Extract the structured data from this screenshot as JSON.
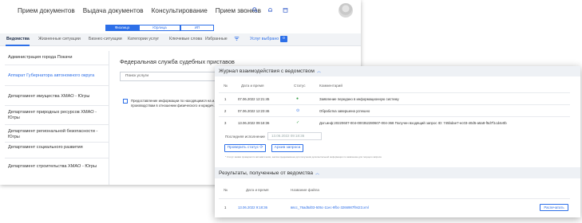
{
  "header": {
    "nav": [
      "Прием документов",
      "Выдача документов",
      "Консультирование",
      "Прием звонков"
    ],
    "icons": [
      "search-icon",
      "bell-icon",
      "calendar-icon"
    ]
  },
  "applicant_types": {
    "items": [
      "Физлицо",
      "Юрлица",
      "ИП"
    ],
    "active": "Физлицо"
  },
  "tabs": {
    "items": [
      "Ведомства",
      "Жизненные ситуации",
      "Бизнес-ситуации",
      "Категории услуг",
      "Ключевые слова",
      "Избранные"
    ],
    "active": "Ведомства",
    "selected_link": "Услуг выбрано",
    "selected_count": "0"
  },
  "sidebar": {
    "items": [
      {
        "label": "Администрация города Покачи"
      },
      {
        "label": "Аппарат Губернатора автономного округа"
      },
      {
        "label": "Департамент имущества ХМАО - Югры"
      },
      {
        "label": "Департамент природных ресурсов ХМАО - Югры"
      },
      {
        "label": "Департамент региональной безопасности - Югры"
      },
      {
        "label": "Департамент социального развития"
      },
      {
        "label": "Департамент строительства ХМАО - Югры"
      }
    ],
    "active_index": 1
  },
  "main": {
    "title": "Федеральная служба судебных приставов",
    "search_placeholder": "Поиск услуги",
    "service_text": "Предоставление информации по находящимся на и... производствам в отношении физического и юридич..."
  },
  "journal": {
    "title": "Журнал взаимодействия с ведомством",
    "columns": [
      "№",
      "Дата и время",
      "Статус",
      "Комментарий"
    ],
    "rows": [
      {
        "n": "1",
        "datetime": "07.06.2022 12:21:45",
        "status": "●",
        "comment": "Заявление передано в информационную систему"
      },
      {
        "n": "2",
        "datetime": "07.06.2022 12:23:46",
        "status": "⊙",
        "comment": "Обработка завершена успешно"
      },
      {
        "n": "3",
        "datetime": "13.06.2022 09:18:36",
        "status": "✓",
        "comment": "Доп.инф:20220607-004-000352280607-004-368 Получен входящий запрос ID: 745bdae7-ec03-40d5-a6a8-f5d7f1cd4e0b"
      }
    ],
    "last_check_label": "Последняя исполнение",
    "last_check_value": "13.06.2022 09:18:36",
    "check_button": "Проверить статус",
    "archive_button": "Архив запроса",
    "note": "* Статус заявки проверяется автоматически, кнопка предназначена для получения дополнительной информации по заявлению для текущего запроса"
  },
  "results": {
    "title": "Результаты, полученные от ведомства",
    "columns": [
      "№",
      "Дата и время",
      "Название файла"
    ],
    "rows": [
      {
        "n": "1",
        "datetime": "13.06.2022 9:18:36",
        "filename": "ввсс_76ad5d03-505c-11ec-9fbc-3266987f9423.xml",
        "action": "Распечатать"
      }
    ]
  },
  "colors": {
    "accent": "#2d6fe8",
    "success": "#3aa04a",
    "header_bg": "#eef1f5"
  }
}
